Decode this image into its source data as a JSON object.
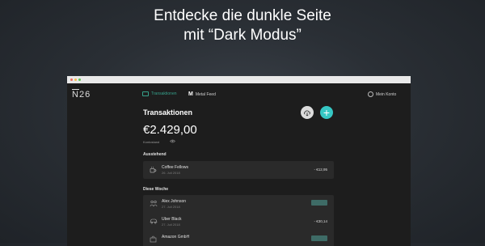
{
  "headline": {
    "line1": "Entdecke die dunkle Seite",
    "line2": "mit “Dark Modus”"
  },
  "app": {
    "logo": {
      "n": "N",
      "rest": "26"
    },
    "nav": {
      "transactions": "Transaktionen",
      "metal_feed": "Metal Feed",
      "account": "Mein Konto"
    },
    "page_title": "Transaktionen",
    "balance": "€2.429,00",
    "balance_label": "Kontostand",
    "sections": {
      "pending": {
        "label": "Ausstehend",
        "rows": [
          {
            "name": "Coffee Fellows",
            "date": "26. Juli 2018",
            "amount": "- €12,95",
            "icon": "coffee-icon"
          }
        ]
      },
      "week": {
        "label": "Diese Woche",
        "rows": [
          {
            "name": "Alex Johnson",
            "date": "27. Juli 2018",
            "amount": "",
            "icon": "transfer-icon"
          },
          {
            "name": "Uber Black",
            "date": "27. Juli 2018",
            "amount": "- €30,14",
            "icon": "car-icon"
          },
          {
            "name": "Amazon GmbH",
            "date": "",
            "amount": "",
            "icon": "shopping-icon"
          }
        ]
      }
    },
    "colors": {
      "accent_teal": "#36a18b",
      "add_button": "#36c7c4",
      "credit_badge": "#3e6b66"
    }
  }
}
